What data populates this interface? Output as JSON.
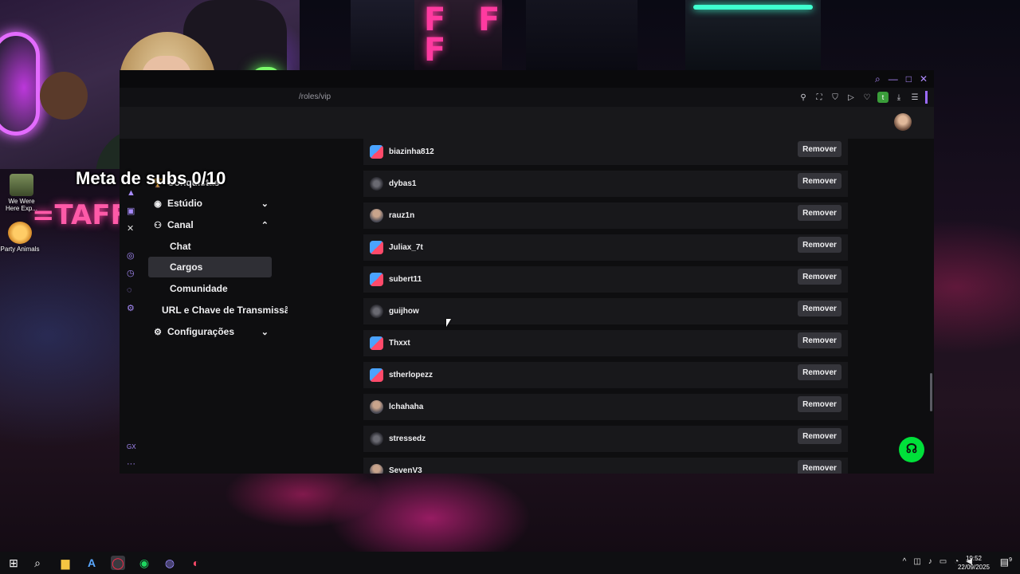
{
  "overlay": {
    "subs_goal": "Meta de subs 0/10"
  },
  "desktop": {
    "icons": [
      {
        "label": "We Were Here Exp..."
      },
      {
        "label": "Party Animals"
      }
    ],
    "banner": "=TAFF"
  },
  "browser": {
    "url": "/roles/vip",
    "window_controls": {
      "search": "⌕",
      "minimize": "—",
      "maximize": "□",
      "close": "✕"
    },
    "ext_badge": "t"
  },
  "sidebar": {
    "items": [
      {
        "label": "Conquistas",
        "icon": "🏆"
      },
      {
        "label": "Estúdio",
        "icon": "◉"
      },
      {
        "label": "Canal",
        "icon": "⚇"
      },
      {
        "label": "Chat"
      },
      {
        "label": "Cargos"
      },
      {
        "label": "Comunidade"
      },
      {
        "label": "URL e Chave de Transmissão"
      },
      {
        "label": "Configurações",
        "icon": "⚙"
      }
    ],
    "rail_bottom": "GX",
    "rail_more": "···"
  },
  "roles_list": {
    "remove_label": "Remover",
    "users": [
      {
        "name": "biazinha812",
        "avatar": "badge"
      },
      {
        "name": "dybas1",
        "avatar": "dark"
      },
      {
        "name": "rauz1n",
        "avatar": "photo"
      },
      {
        "name": "Juliax_7t",
        "avatar": "badge"
      },
      {
        "name": "subert11",
        "avatar": "badge"
      },
      {
        "name": "guijhow",
        "avatar": "dark"
      },
      {
        "name": "Thxxt",
        "avatar": "badge"
      },
      {
        "name": "stherlopezz",
        "avatar": "badge"
      },
      {
        "name": "lchahaha",
        "avatar": "photo"
      },
      {
        "name": "stressedz",
        "avatar": "dark"
      },
      {
        "name": "SevenV3",
        "avatar": "photo"
      }
    ]
  },
  "taskbar": {
    "time": "19:52",
    "date": "22/09/2025",
    "notifications": "9"
  }
}
